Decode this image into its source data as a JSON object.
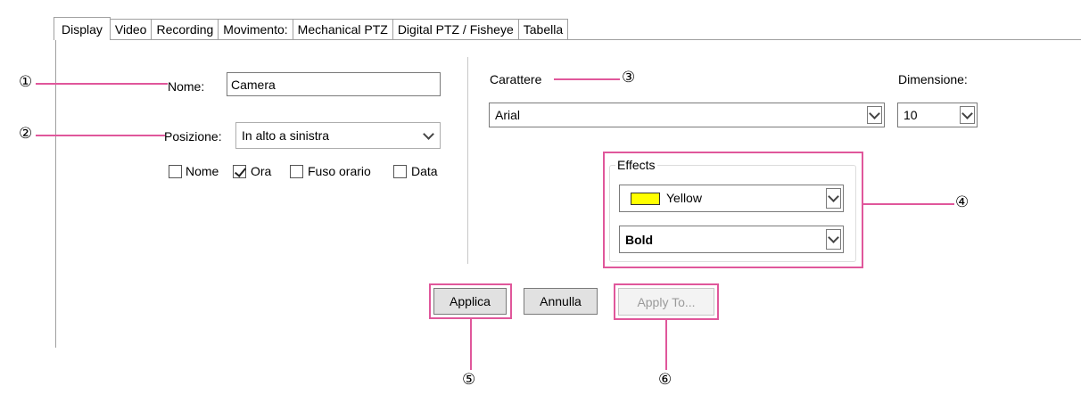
{
  "tabs": [
    {
      "label": "Display",
      "active": true
    },
    {
      "label": "Video"
    },
    {
      "label": "Recording"
    },
    {
      "label": "Movimento:"
    },
    {
      "label": "Mechanical PTZ"
    },
    {
      "label": "Digital PTZ / Fisheye"
    },
    {
      "label": "Tabella"
    }
  ],
  "left": {
    "name_label": "Nome:",
    "name_value": "Camera",
    "position_label": "Posizione:",
    "position_value": "In alto a sinistra",
    "checkboxes": [
      {
        "label": "Nome",
        "checked": false
      },
      {
        "label": "Ora",
        "checked": true
      },
      {
        "label": "Fuso orario",
        "checked": false
      },
      {
        "label": "Data",
        "checked": false
      }
    ]
  },
  "right": {
    "font_label": "Carattere",
    "size_label": "Dimensione:",
    "font_value": "Arial",
    "size_value": "10",
    "effects_title": "Effects",
    "color_value": "Yellow",
    "color_swatch": "#ffff00",
    "style_value": "Bold"
  },
  "buttons": {
    "apply": "Applica",
    "cancel": "Annulla",
    "apply_to": "Apply To..."
  },
  "callouts": [
    "①",
    "②",
    "③",
    "④",
    "⑤",
    "⑥"
  ],
  "colors": {
    "callout": "#e0579b"
  }
}
